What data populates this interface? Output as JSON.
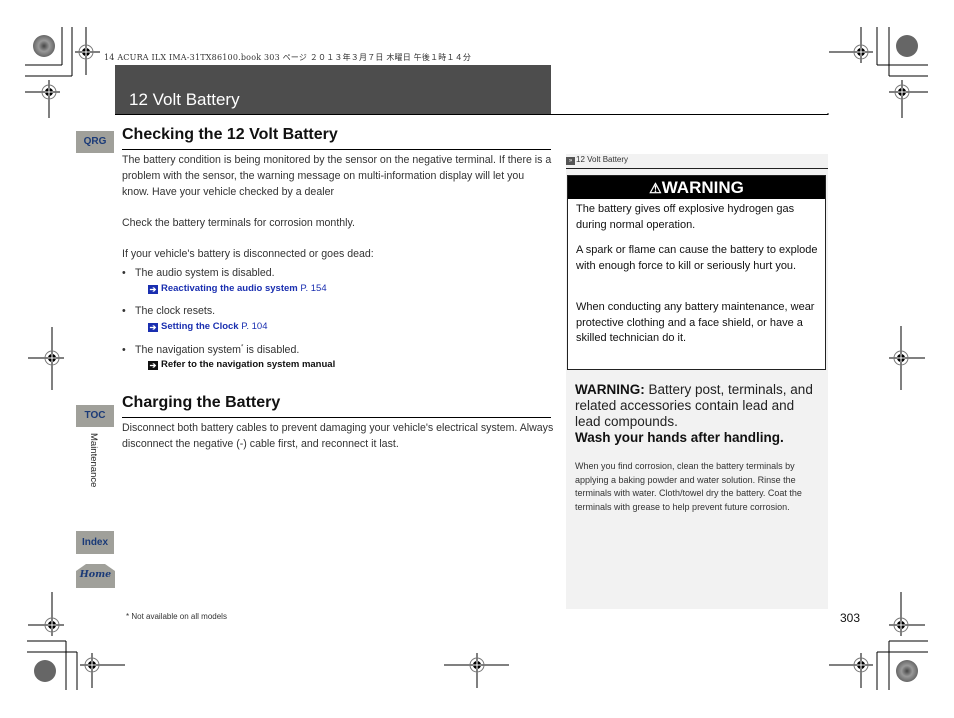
{
  "header": {
    "printer_line": "14 ACURA ILX IMA-31TX86100.book  303 ページ  ２０１３年３月７日  木曜日  午後１時１４分",
    "page_title": "12 Volt Battery"
  },
  "side_nav": {
    "qrg_label": "QRG",
    "toc_label": "TOC",
    "index_label": "Index",
    "home_label": "Home",
    "section_label": "Maintenance"
  },
  "main": {
    "checking": {
      "heading": "Checking the 12 Volt Battery",
      "para1": "The battery condition is being monitored by the sensor on the negative terminal. If there is a problem with the sensor, the warning message on multi-information display will let you know. Have your vehicle checked by a dealer",
      "para2": "Check the battery terminals for corrosion monthly.",
      "para3": "If your vehicle's battery is disconnected or goes dead:",
      "bullets": [
        {
          "text": "The audio system is disabled.",
          "xref": "Reactivating the audio system",
          "page": "P. 154"
        },
        {
          "text": "The clock resets.",
          "xref": "Setting the Clock",
          "page": "P. 104"
        },
        {
          "text": "The navigation system",
          "sup": "*",
          "text_after": " is disabled.",
          "xref": "Refer to the navigation system manual",
          "page": ""
        }
      ]
    },
    "charging": {
      "heading": "Charging the Battery",
      "para": "Disconnect both battery cables to prevent damaging your vehicle's electrical system. Always disconnect the negative (-) cable first, and reconnect it last."
    }
  },
  "sidebar": {
    "header": "12 Volt Battery",
    "header_icon": "double-chevron-icon",
    "warning": {
      "title": "WARNING",
      "icon": "warning-triangle-icon",
      "p1": "The battery gives off explosive hydrogen gas during normal operation.",
      "p2": "A spark or flame can cause the battery to explode with enough force to kill or seriously hurt you.",
      "p3": "When conducting any battery maintenance, wear protective clothing and a face shield, or have a skilled technician do it."
    },
    "lead_warning": {
      "label": "WARNING:",
      "text": " Battery post, terminals, and related accessories contain lead and lead compounds.",
      "emphasis": "Wash your hands after handling."
    },
    "corrosion_note": "When you find corrosion, clean the battery terminals by applying a baking powder and water solution. Rinse the terminals with water. Cloth/towel dry the battery. Coat the terminals with grease to help prevent future corrosion."
  },
  "footer": {
    "footnote": "* Not available on all models",
    "page_number": "303"
  },
  "colors": {
    "title_bar": "#4d4d4d",
    "tab_bg": "#a0a09a",
    "tab_text": "#1a3a78",
    "xref_blue": "#1a2fb0",
    "sidebar_bg": "#f2f2f2"
  }
}
